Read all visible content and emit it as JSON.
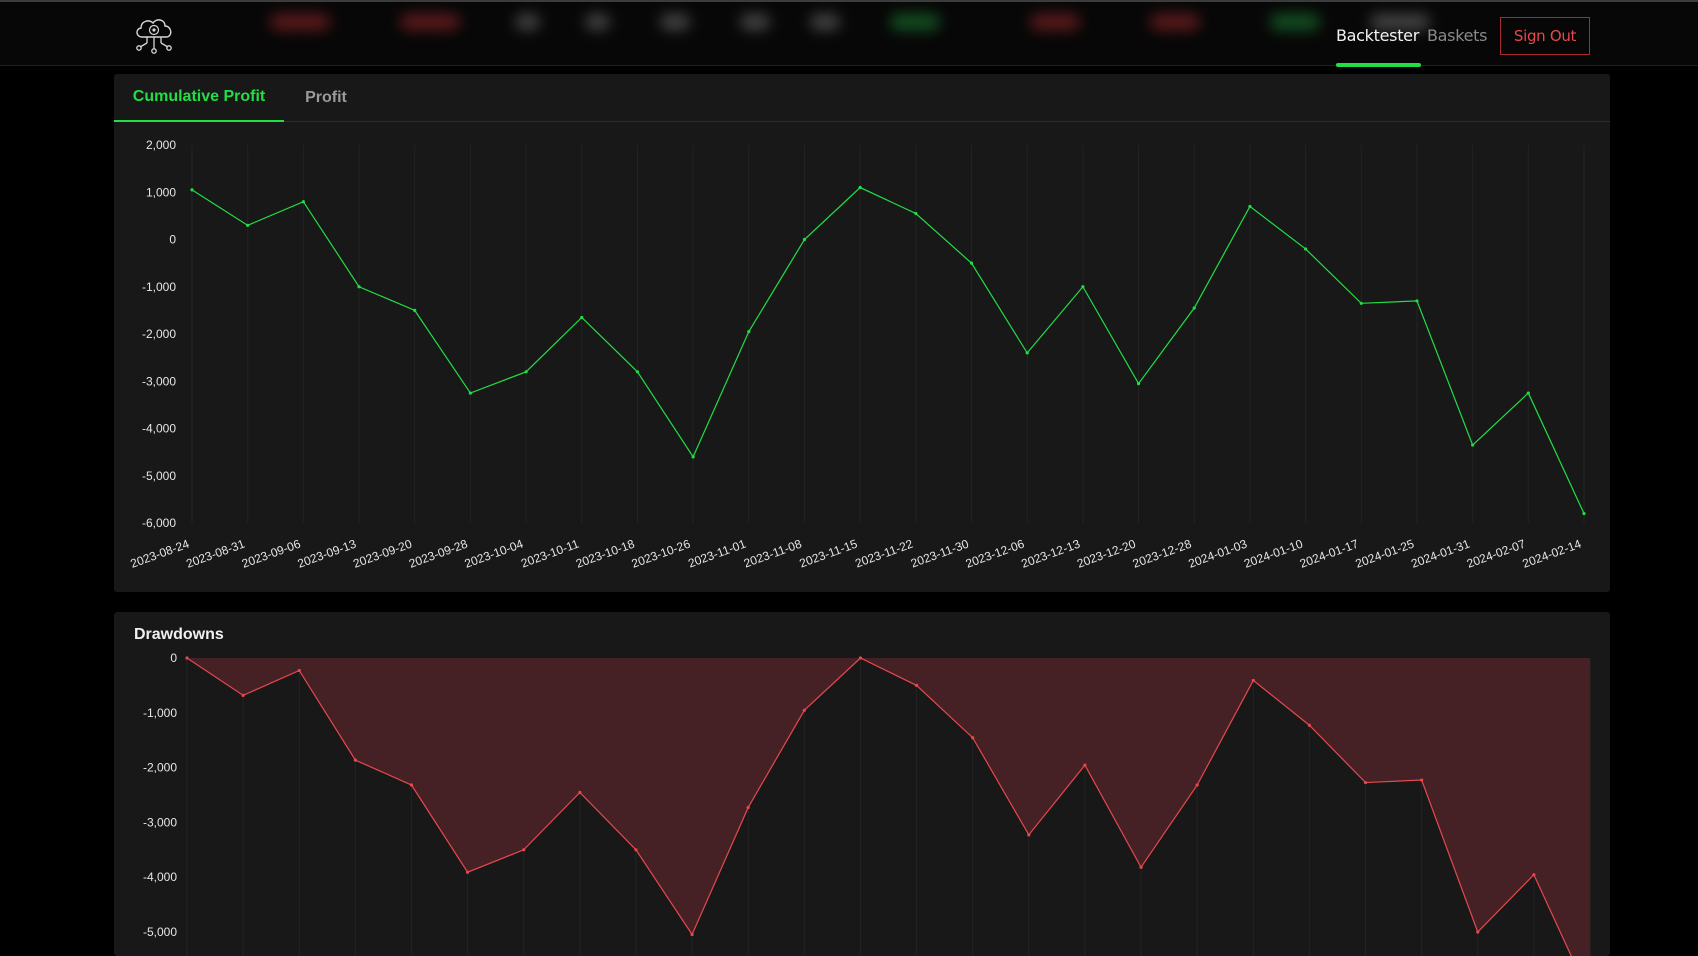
{
  "nav": {
    "active_item": "Backtester",
    "secondary_item": "Baskets",
    "sign_out": "Sign Out"
  },
  "colors": {
    "accent": "#22dd44",
    "danger": "#e5484d",
    "drawdown_fill": "#452125",
    "panel": "#181819"
  },
  "icons": {
    "logo": "cloud-network-icon"
  },
  "tabs": [
    {
      "label": "Cumulative Profit",
      "active": true
    },
    {
      "label": "Profit",
      "active": false
    }
  ],
  "drawdowns_panel": {
    "title": "Drawdowns"
  },
  "chart_data": [
    {
      "type": "line",
      "title": "",
      "x": [
        "2023-08-24",
        "2023-08-31",
        "2023-09-06",
        "2023-09-13",
        "2023-09-20",
        "2023-09-28",
        "2023-10-04",
        "2023-10-11",
        "2023-10-18",
        "2023-10-26",
        "2023-11-01",
        "2023-11-08",
        "2023-11-15",
        "2023-11-22",
        "2023-11-30",
        "2023-12-06",
        "2023-12-13",
        "2023-12-20",
        "2023-12-28",
        "2024-01-03",
        "2024-01-10",
        "2024-01-17",
        "2024-01-25",
        "2024-01-31",
        "2024-02-07",
        "2024-02-14"
      ],
      "series": [
        {
          "values": [
            1050,
            300,
            800,
            -1000,
            -1500,
            -3250,
            -2800,
            -1650,
            -2800,
            -4600,
            -1950,
            0,
            1100,
            550,
            -500,
            -2400,
            -1000,
            -3050,
            -1450,
            700,
            -200,
            -1350,
            -1300,
            -4350,
            -3250,
            -5800
          ]
        }
      ],
      "ylim": [
        -6000,
        2000
      ],
      "yticks": [
        "2,000",
        "1,000",
        "0",
        "-1,000",
        "-2,000",
        "-3,000",
        "-4,000",
        "-5,000",
        "-6,000"
      ],
      "grid": true,
      "color": "#22dd44"
    },
    {
      "type": "area",
      "title": "Drawdowns",
      "x": [
        "2023-08-24",
        "2023-08-31",
        "2023-09-06",
        "2023-09-13",
        "2023-09-20",
        "2023-09-28",
        "2023-10-04",
        "2023-10-11",
        "2023-10-18",
        "2023-10-26",
        "2023-11-01",
        "2023-11-08",
        "2023-11-15",
        "2023-11-22",
        "2023-11-30",
        "2023-12-06",
        "2023-12-13",
        "2023-12-20",
        "2023-12-28",
        "2024-01-03",
        "2024-01-10",
        "2024-01-17",
        "2024-01-25",
        "2024-01-31",
        "2024-02-07",
        "2024-02-14"
      ],
      "series": [
        {
          "values": [
            0,
            -750,
            -250,
            -2050,
            -2550,
            -4300,
            -3850,
            -2700,
            -3850,
            -5550,
            -3000,
            -1050,
            0,
            -550,
            -1600,
            -3550,
            -2150,
            -4200,
            -2550,
            -450,
            -1350,
            -2500,
            -2450,
            -5500,
            -4350,
            -6800
          ]
        }
      ],
      "ylim": [
        -5500,
        0
      ],
      "yticks": [
        "0",
        "-1,000",
        "-2,000",
        "-3,000",
        "-4,000",
        "-5,000"
      ],
      "grid": true,
      "color": "#e5484d"
    }
  ]
}
